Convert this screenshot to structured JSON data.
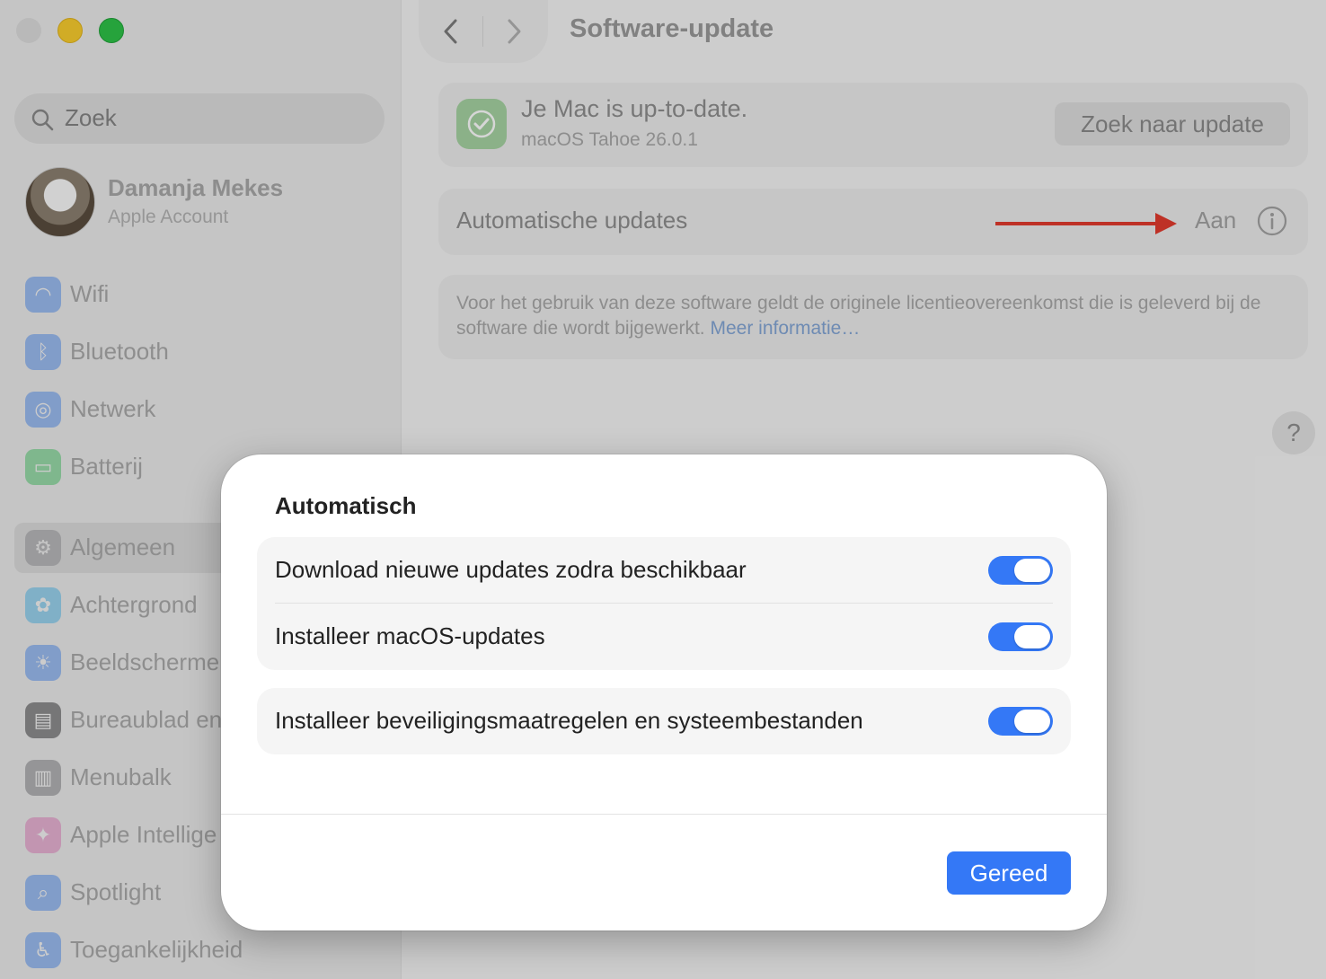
{
  "window": {
    "title": "Software-update"
  },
  "sidebar": {
    "search_placeholder": "Zoek",
    "account": {
      "name": "Damanja Mekes",
      "subtitle": "Apple Account"
    },
    "items": [
      {
        "label": "Wifi",
        "icon": "wifi-icon",
        "color": "#3a82f7"
      },
      {
        "label": "Bluetooth",
        "icon": "bluetooth-icon",
        "color": "#3a82f7"
      },
      {
        "label": "Netwerk",
        "icon": "globe-icon",
        "color": "#3a82f7"
      },
      {
        "label": "Batterij",
        "icon": "battery-icon",
        "color": "#34c759"
      },
      {
        "label": "Algemeen",
        "icon": "gear-icon",
        "color": "#8e8e93",
        "selected": true
      },
      {
        "label": "Achtergrond",
        "icon": "flower-icon",
        "color": "#38b6f2"
      },
      {
        "label": "Beeldscherme",
        "icon": "sun-icon",
        "color": "#3a82f7"
      },
      {
        "label": "Bureaublad en",
        "icon": "dock-icon",
        "color": "#1c1c1e"
      },
      {
        "label": "Menubalk",
        "icon": "menubar-icon",
        "color": "#6e6e73"
      },
      {
        "label": "Apple Intellige",
        "icon": "apple-intelligence-icon",
        "color": "#e36fb8"
      },
      {
        "label": "Spotlight",
        "icon": "magnifier-icon",
        "color": "#3a82f7"
      },
      {
        "label": "Toegankelijkheid",
        "icon": "accessibility-icon",
        "color": "#3a82f7"
      }
    ]
  },
  "main": {
    "status": {
      "title": "Je Mac is up-to-date.",
      "version": "macOS Tahoe 26.0.1",
      "check_button": "Zoek naar update"
    },
    "auto_updates": {
      "label": "Automatische updates",
      "value": "Aan",
      "arrow_color": "#e33b2e"
    },
    "license": {
      "text": "Voor het gebruik van deze software geldt de originele licentieovereenkomst die is geleverd bij de software die wordt bijgewerkt.",
      "link": "Meer informatie…"
    },
    "help": "?"
  },
  "sheet": {
    "title": "Automatisch",
    "groups": [
      {
        "rows": [
          {
            "label": "Download nieuwe updates zodra beschikbaar",
            "on": true
          },
          {
            "label": "Installeer macOS-updates",
            "on": true
          }
        ]
      },
      {
        "rows": [
          {
            "label": "Installeer beveiligingsmaatregelen en systeembestanden",
            "on": true
          }
        ]
      }
    ],
    "done_button": "Gereed"
  },
  "colors": {
    "accent": "#3478f6"
  }
}
